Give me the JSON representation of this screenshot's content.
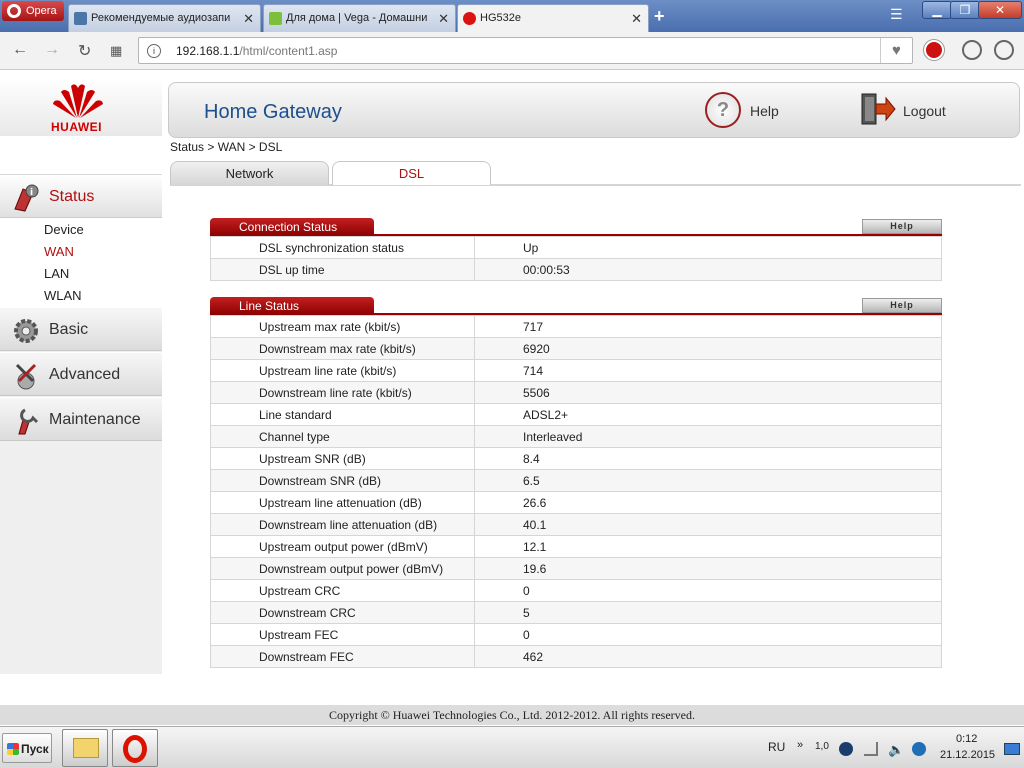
{
  "browser": {
    "menu_label": "Opera",
    "tabs": [
      {
        "title": "Рекомендуемые аудиозапи"
      },
      {
        "title": "Для дома | Vega - Домашни"
      },
      {
        "title": "HG532e"
      }
    ],
    "tab_close": "✕",
    "new_tab": "+",
    "window_controls": {
      "minimize": "▁",
      "maximize": "❐",
      "close": "✕"
    },
    "address": {
      "host": "192.168.1.1",
      "path": "/html/content1.asp"
    }
  },
  "brand": {
    "name": "HUAWEI",
    "color": "#cc0000"
  },
  "header": {
    "title": "Home Gateway",
    "help_label": "Help",
    "logout_label": "Logout"
  },
  "breadcrumb": "Status > WAN > DSL",
  "page_tabs": [
    {
      "label": "Network",
      "active": false
    },
    {
      "label": "DSL",
      "active": true
    }
  ],
  "sidebar": {
    "status": {
      "label": "Status",
      "icon": "status-icon"
    },
    "status_items": [
      {
        "label": "Device",
        "active": false
      },
      {
        "label": "WAN",
        "active": true
      },
      {
        "label": "LAN",
        "active": false
      },
      {
        "label": "WLAN",
        "active": false
      }
    ],
    "sections": [
      {
        "label": "Basic",
        "icon": "gear-icon"
      },
      {
        "label": "Advanced",
        "icon": "tools-icon"
      },
      {
        "label": "Maintenance",
        "icon": "wrench-icon"
      }
    ]
  },
  "connection_status": {
    "title": "Connection Status",
    "help_label": "Help",
    "rows": [
      {
        "key": "DSL synchronization status",
        "value": "Up"
      },
      {
        "key": "DSL up time",
        "value": "00:00:53"
      }
    ]
  },
  "line_status": {
    "title": "Line Status",
    "help_label": "Help",
    "rows": [
      {
        "key": "Upstream max rate (kbit/s)",
        "value": "717"
      },
      {
        "key": "Downstream max rate (kbit/s)",
        "value": "6920"
      },
      {
        "key": "Upstream line rate (kbit/s)",
        "value": "714"
      },
      {
        "key": "Downstream line rate (kbit/s)",
        "value": "5506"
      },
      {
        "key": "Line standard",
        "value": "ADSL2+"
      },
      {
        "key": "Channel type",
        "value": "Interleaved"
      },
      {
        "key": "Upstream SNR (dB)",
        "value": "8.4"
      },
      {
        "key": "Downstream SNR (dB)",
        "value": "6.5"
      },
      {
        "key": "Upstream line attenuation (dB)",
        "value": "26.6"
      },
      {
        "key": "Downstream line attenuation (dB)",
        "value": "40.1"
      },
      {
        "key": "Upstream output power (dBmV)",
        "value": "12.1"
      },
      {
        "key": "Downstream output power (dBmV)",
        "value": "19.6"
      },
      {
        "key": "Upstream CRC",
        "value": "0"
      },
      {
        "key": "Downstream CRC",
        "value": "5"
      },
      {
        "key": "Upstream FEC",
        "value": "0"
      },
      {
        "key": "Downstream FEC",
        "value": "462"
      }
    ]
  },
  "footer": "Copyright © Huawei Technologies Co., Ltd. 2012-2012. All rights reserved.",
  "taskbar": {
    "start_label": "Пуск",
    "language": "RU",
    "tray_value": "1,0",
    "time": "0:12",
    "date": "21.12.2015"
  },
  "colors": {
    "accent_red": "#b01010",
    "title_blue": "#1c4f8c",
    "section_red": "#9b0000"
  }
}
